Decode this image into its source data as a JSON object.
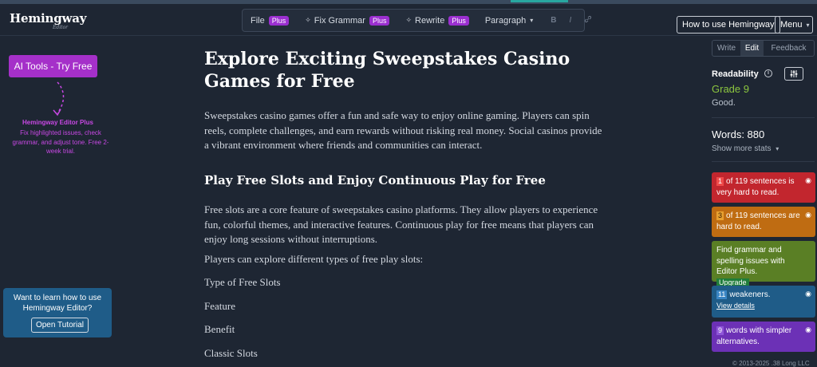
{
  "header": {
    "logo": "Hemingway",
    "logo_sub": "Editor",
    "toolbar": {
      "file_label": "File",
      "plus_badge": "Plus",
      "fix_grammar_label": "Fix Grammar",
      "rewrite_label": "Rewrite",
      "paragraph_label": "Paragraph",
      "bold_glyph": "B",
      "italic_glyph": "I",
      "link_glyph": "⊘"
    },
    "how_to_label": "How to use Hemingway",
    "menu_label": "Menu"
  },
  "left": {
    "ai_button": "AI Tools - Try Free",
    "promo_title": "Hemingway Editor Plus",
    "promo_text": "Fix highlighted issues, check grammar, and adjust tone. Free 2-week trial.",
    "tutorial_text": "Want to learn how to use Hemingway Editor?",
    "tutorial_button": "Open Tutorial"
  },
  "document": {
    "title": "Explore Exciting Sweepstakes Casino Games for Free",
    "intro": "Sweepstakes casino games offer a fun and safe way to enjoy online gaming. Players can spin reels, complete challenges, and earn rewards without risking real money. Social casinos provide a vibrant environment where friends and communities can interact.",
    "heading2": "Play Free Slots and Enjoy Continuous Play for Free",
    "para2": "Free slots are a core feature of sweepstakes casino platforms. They allow players to experience fun, colorful themes, and interactive features. Continuous play for free means that players can enjoy long sessions without interruptions.",
    "para3": "Players can explore different types of free play slots:",
    "line1": "Type of Free Slots",
    "line2": "Feature",
    "line3": "Benefit",
    "line4": "Classic Slots"
  },
  "sidebar": {
    "tabs": [
      "Write",
      "Edit",
      "Feedback"
    ],
    "readability_label": "Readability",
    "grade": "Grade 9",
    "grade_desc": "Good.",
    "words": "Words: 880",
    "show_more": "Show more stats",
    "cards": {
      "very_hard_num": "1",
      "very_hard_text": "of 119 sentences is very hard to read.",
      "hard_num": "3",
      "hard_text": "of 119 sentences are hard to read.",
      "grammar_text": "Find grammar and spelling issues with Editor Plus.",
      "upgrade": "Upgrade",
      "weakeners_num": "11",
      "weakeners_text": "weakeners.",
      "view_details": "View details",
      "simpler_num": "9",
      "simpler_text": "words with simpler alternatives."
    },
    "copyright": "© 2013-2025 .38 Long LLC"
  },
  "colors": {
    "background": "#1e2633",
    "accent_purple": "#a530c9",
    "grade_green": "#8cc63f",
    "card_red": "#c2262e",
    "card_orange": "#bf6c12",
    "card_green": "#5a7f25",
    "card_blue": "#1f5c88",
    "card_purple": "#6c31b6"
  }
}
